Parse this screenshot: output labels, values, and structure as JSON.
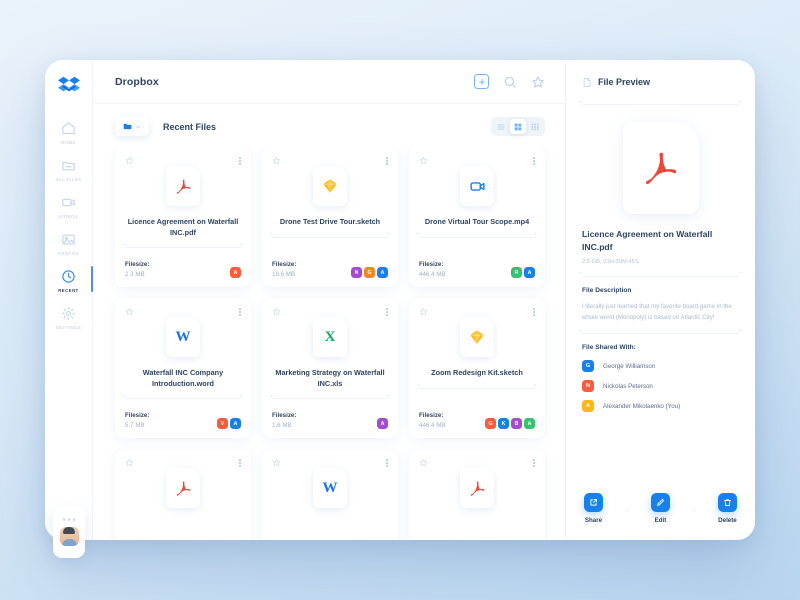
{
  "window": {
    "app_title": "Dropbox"
  },
  "sidebar": {
    "logo_name": "dropbox-logo",
    "items": [
      {
        "label": "HOME",
        "icon": "home-icon",
        "active": false
      },
      {
        "label": "ALL FILES",
        "icon": "folder-icon",
        "active": false
      },
      {
        "label": "VIDEOS",
        "icon": "video-icon",
        "active": false
      },
      {
        "label": "PHOTOS",
        "icon": "photo-icon",
        "active": false
      },
      {
        "label": "RECENT",
        "icon": "clock-icon",
        "active": true
      },
      {
        "label": "SETTINGS",
        "icon": "gear-icon",
        "active": false
      }
    ]
  },
  "topbar": {
    "add_icon": "add-box-icon",
    "search_icon": "search-icon",
    "star_icon": "star-icon"
  },
  "toolbar": {
    "folder_icon": "folder-icon",
    "chevron_icon": "chevron-down-icon",
    "section_title": "Recent Files",
    "views": [
      {
        "name": "list-view",
        "icon": "list-icon",
        "active": false
      },
      {
        "name": "grid-view",
        "icon": "grid-icon",
        "active": true
      },
      {
        "name": "compact-view",
        "icon": "compact-grid-icon",
        "active": false
      }
    ]
  },
  "files": [
    {
      "name": "Licence Agreement on Waterfall INC.pdf",
      "type": "pdf",
      "filesize_label": "Filesize:",
      "filesize": "2.3 MB",
      "avatars": [
        {
          "letter": "A",
          "color": "#fa5d3d"
        }
      ]
    },
    {
      "name": "Drone Test Drive Tour.sketch",
      "type": "sketch",
      "filesize_label": "Filesize:",
      "filesize": "18.6 MB",
      "avatars": [
        {
          "letter": "N",
          "color": "#a44bd4"
        },
        {
          "letter": "G",
          "color": "#f5841f"
        },
        {
          "letter": "A",
          "color": "#1780eb"
        }
      ]
    },
    {
      "name": "Drone Virtual Tour Scope.mp4",
      "type": "video",
      "filesize_label": "Filesize:",
      "filesize": "446.4 MB",
      "avatars": [
        {
          "letter": "R",
          "color": "#35c271"
        },
        {
          "letter": "A",
          "color": "#1780eb"
        }
      ]
    },
    {
      "name": "Waterfall INC Company Introduction.word",
      "type": "word",
      "filesize_label": "Filesize:",
      "filesize": "5.7 MB",
      "avatars": [
        {
          "letter": "V",
          "color": "#fa5d3d"
        },
        {
          "letter": "A",
          "color": "#1780eb"
        }
      ]
    },
    {
      "name": "Marketing Strategy on Waterfall INC.xls",
      "type": "excel",
      "filesize_label": "Filesize:",
      "filesize": "1.6 MB",
      "avatars": [
        {
          "letter": "A",
          "color": "#a44bd4"
        }
      ]
    },
    {
      "name": "Zoom Redesign Kit.sketch",
      "type": "sketch",
      "filesize_label": "Filesize:",
      "filesize": "446.4 MB",
      "avatars": [
        {
          "letter": "G",
          "color": "#fa5d3d"
        },
        {
          "letter": "K",
          "color": "#1780eb"
        },
        {
          "letter": "B",
          "color": "#a44bd4"
        },
        {
          "letter": "A",
          "color": "#35c271"
        }
      ]
    },
    {
      "name": "",
      "type": "pdf",
      "filesize_label": "",
      "filesize": "",
      "avatars": []
    },
    {
      "name": "",
      "type": "word",
      "filesize_label": "",
      "filesize": "",
      "avatars": []
    },
    {
      "name": "",
      "type": "pdf",
      "filesize_label": "",
      "filesize": "",
      "avatars": []
    }
  ],
  "preview": {
    "panel_title": "File Preview",
    "doc_icon": "document-icon",
    "file_name": "Licence Agreement on Waterfall INC.pdf",
    "file_meta": "2.5 GB, 01H:30M:45S",
    "description_title": "File Description",
    "description": "I literally just learned that my favorite board game in the whole world (Monopoly) is based on Atlantic City!",
    "shared_title": "File Shared With:",
    "shared_with": [
      {
        "letter": "G",
        "name": "George Williamson",
        "color": "#1780eb"
      },
      {
        "letter": "N",
        "name": "Nickolas Peterson",
        "color": "#fa5d3d"
      },
      {
        "letter": "A",
        "name": "Alexander Mikolaenko (You)",
        "color": "#fdb813"
      }
    ],
    "actions": [
      {
        "label": "Share",
        "icon": "share-icon"
      },
      {
        "label": "Edit",
        "icon": "edit-icon"
      },
      {
        "label": "Delete",
        "icon": "trash-icon"
      }
    ]
  },
  "colors": {
    "accent": "#1780eb",
    "text_dark": "#2f4562",
    "text_muted": "#a9bccf"
  }
}
